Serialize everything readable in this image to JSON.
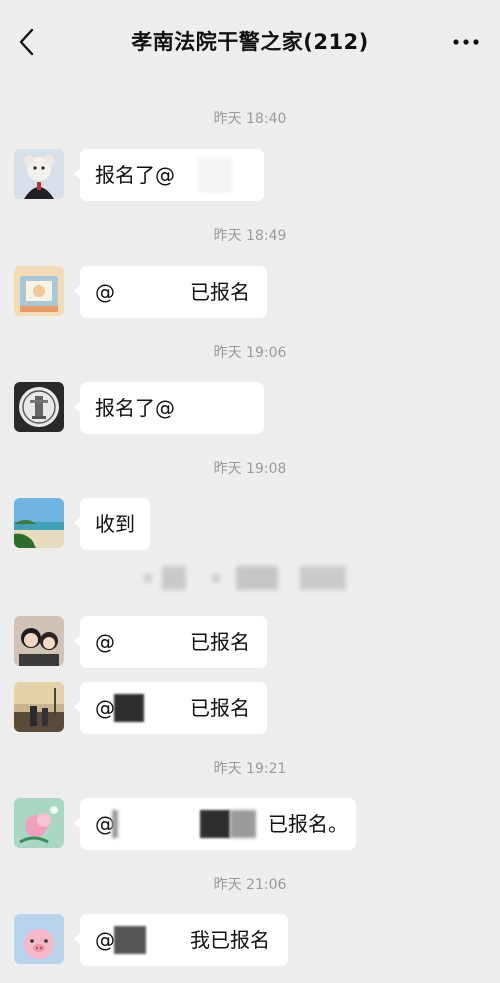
{
  "header": {
    "title": "孝南法院干警之家(212)",
    "back_icon": "chevron-left-icon",
    "more_icon": "more-dots-icon"
  },
  "messages": [
    {
      "time": "昨天 18:40",
      "text": "报名了@"
    },
    {
      "time": "昨天 18:49",
      "at": "@",
      "text": "已报名"
    },
    {
      "time": "昨天 19:06",
      "text": "报名了@"
    },
    {
      "time": "昨天 19:08",
      "text": "收到"
    },
    {
      "at": "@",
      "text": "已报名"
    },
    {
      "at": "@",
      "text": "已报名"
    },
    {
      "time": "昨天 19:21",
      "at": "@",
      "text": "已报名。"
    },
    {
      "time": "昨天 21:06",
      "at": "@",
      "text": "我已报名"
    }
  ],
  "colors": {
    "background": "#ededed",
    "bubble": "#ffffff",
    "timestamp": "#9a9a9a"
  }
}
